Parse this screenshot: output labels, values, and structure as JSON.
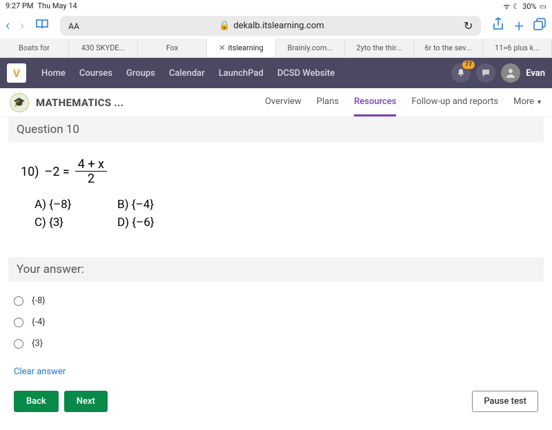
{
  "status": {
    "time": "9:27 PM",
    "date": "Thu May 14",
    "battery": "30%"
  },
  "browser": {
    "font": "AA",
    "url": "dekalb.itslearning.com"
  },
  "tabs": [
    "Boats for",
    "430 SKYDE...",
    "Fox",
    "itslearning",
    "Brainly.com...",
    "2yto the thir...",
    "6r to the sev...",
    "11=6 plus k..."
  ],
  "activeTab": 3,
  "nav": {
    "items": [
      "Home",
      "Courses",
      "Groups",
      "Calendar",
      "LaunchPad",
      "DCSD Website"
    ],
    "badge": "77",
    "user": "Evan"
  },
  "course": {
    "title": "MATHEMATICS ...",
    "tabs": [
      "Overview",
      "Plans",
      "Resources",
      "Follow-up and reports",
      "More"
    ],
    "active": 2
  },
  "question": {
    "header": "Question 10",
    "num": "10)",
    "lhs": "–2 =",
    "fracNum": "4 + x",
    "fracDen": "2",
    "choices": {
      "a": "A)  {–8}",
      "b": "B)  {–4}",
      "c": "C)  {3}",
      "d": "D)  {–6}"
    }
  },
  "answer": {
    "header": "Your answer:",
    "options": [
      "{-8}",
      "{-4}",
      "{3}"
    ],
    "clear": "Clear answer"
  },
  "footer": {
    "back": "Back",
    "next": "Next",
    "pause": "Pause test"
  }
}
